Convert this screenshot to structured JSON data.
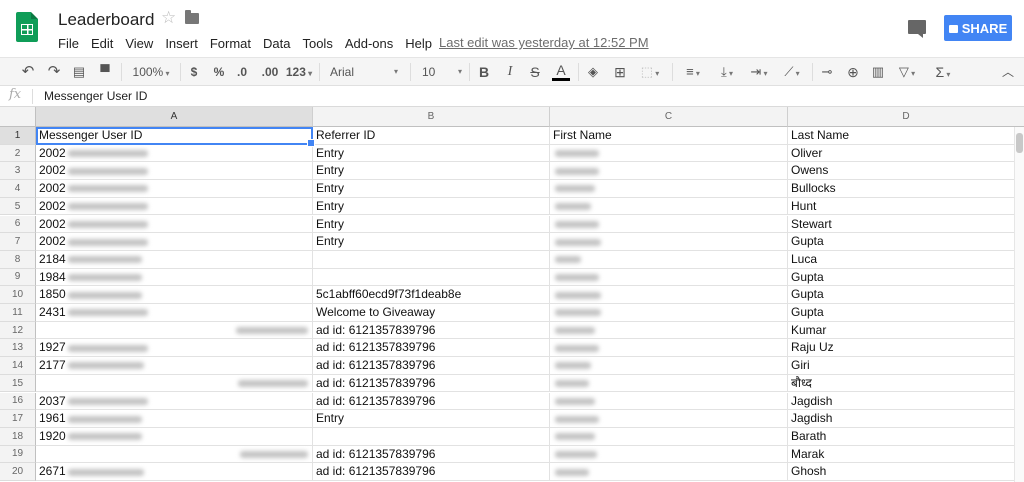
{
  "app": {
    "doc_title": "Leaderboard",
    "last_edit": "Last edit was yesterday at 12:52 PM",
    "share_label": "SHARE",
    "menus": [
      "File",
      "Edit",
      "View",
      "Insert",
      "Format",
      "Data",
      "Tools",
      "Add-ons",
      "Help"
    ]
  },
  "toolbar": {
    "zoom": "100%",
    "currency": "$",
    "percent": "%",
    "dec_less": ".0",
    "dec_more": ".00",
    "more_formats": "123",
    "font": "Arial",
    "font_size": "10",
    "bold": "B",
    "italic": "I",
    "strike": "S",
    "text_color": "A",
    "functions": "Σ"
  },
  "formula_bar": {
    "fx_label": "fx",
    "value": "Messenger User ID"
  },
  "sheet": {
    "columns": [
      "A",
      "B",
      "C",
      "D"
    ],
    "rows": [
      {
        "num": "1",
        "a": "Messenger User ID",
        "b": "Referrer ID",
        "c": "First Name",
        "d": "Last Name"
      },
      {
        "num": "2",
        "a": "2002",
        "b": "Entry",
        "c": "",
        "d": "Oliver"
      },
      {
        "num": "3",
        "a": "2002",
        "b": "Entry",
        "c": "",
        "d": "Owens"
      },
      {
        "num": "4",
        "a": "2002",
        "b": "Entry",
        "c": "",
        "d": "Bullocks"
      },
      {
        "num": "5",
        "a": "2002",
        "b": "Entry",
        "c": "",
        "d": "Hunt"
      },
      {
        "num": "6",
        "a": "2002",
        "b": "Entry",
        "c": "",
        "d": "Stewart"
      },
      {
        "num": "7",
        "a": "2002",
        "b": "Entry",
        "c": "",
        "d": "Gupta"
      },
      {
        "num": "8",
        "a": "2184",
        "b": "",
        "c": "",
        "d": "Luca"
      },
      {
        "num": "9",
        "a": "1984",
        "b": "",
        "c": "",
        "d": "Gupta"
      },
      {
        "num": "10",
        "a": "1850",
        "b": "5c1abff60ecd9f73f1deab8e",
        "c": "",
        "d": "Gupta"
      },
      {
        "num": "11",
        "a": "2431",
        "b": "Welcome to Giveaway",
        "c": "",
        "d": "Gupta"
      },
      {
        "num": "12",
        "a": "",
        "b": "ad id: 6121357839796",
        "c": "",
        "d": "Kumar"
      },
      {
        "num": "13",
        "a": "1927",
        "b": "ad id: 6121357839796",
        "c": "",
        "d": "Raju Uz"
      },
      {
        "num": "14",
        "a": "2177",
        "b": "ad id: 6121357839796",
        "c": "",
        "d": "Giri"
      },
      {
        "num": "15",
        "a": "",
        "b": "ad id: 6121357839796",
        "c": "",
        "d": "बौध्द"
      },
      {
        "num": "16",
        "a": "2037",
        "b": "ad id: 6121357839796",
        "c": "",
        "d": "Jagdish"
      },
      {
        "num": "17",
        "a": "1961",
        "b": "Entry",
        "c": "",
        "d": "Jagdish"
      },
      {
        "num": "18",
        "a": "1920",
        "b": "",
        "c": "",
        "d": "Barath"
      },
      {
        "num": "19",
        "a": "",
        "b": "ad id: 6121357839796",
        "c": "",
        "d": "Marak"
      },
      {
        "num": "20",
        "a": "2671",
        "b": "ad id: 6121357839796",
        "c": "",
        "d": "Ghosh"
      }
    ]
  },
  "colors": {
    "brand_green": "#0f9d58",
    "share_blue": "#4285f4",
    "selection": "#4285f4"
  },
  "icons": [
    "sheets-logo-icon",
    "star-icon",
    "folder-icon",
    "comments-icon",
    "lock-icon",
    "undo-icon",
    "redo-icon",
    "print-icon",
    "paint-format-icon",
    "paint-bucket-icon",
    "borders-icon",
    "merge-icon",
    "align-left-icon",
    "valign-bottom-icon",
    "text-wrap-icon",
    "text-rotate-icon",
    "link-icon",
    "insert-comment-icon",
    "insert-chart-icon",
    "filter-icon",
    "collapse-icon"
  ]
}
